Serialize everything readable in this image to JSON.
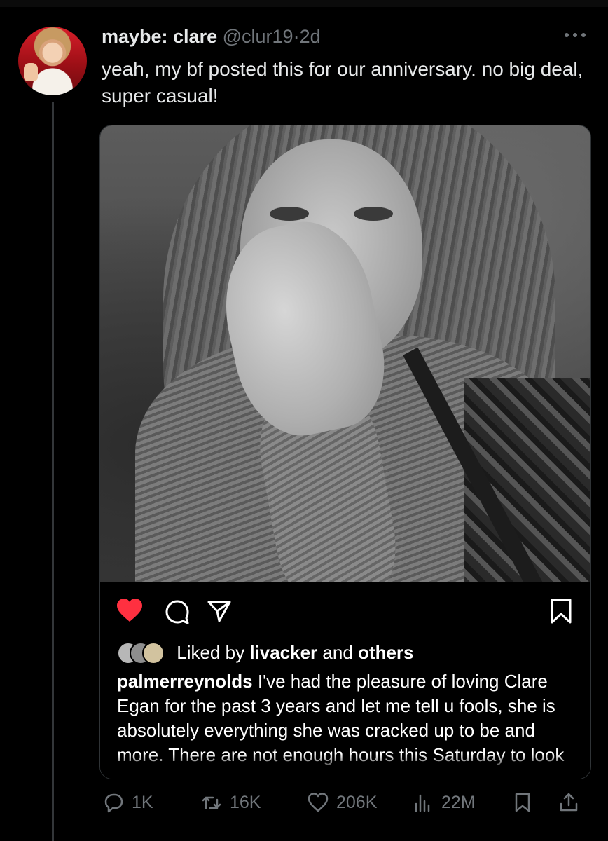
{
  "tweet": {
    "display_name": "maybe: clare",
    "handle": "@clur19",
    "separator": "·",
    "time": "2d",
    "text": "yeah, my bf posted this for our anniversary. no big deal, super casual!"
  },
  "instagram": {
    "liked_prefix": "Liked by",
    "liked_user": "livacker",
    "liked_and": "and",
    "liked_others": "others",
    "caption_user": "palmerreynolds",
    "caption_text": "I've had the pleasure of loving Clare Egan for the past 3 years and let me tell u fools, she is absolutely everything she was cracked up to be and more. There are not enough hours this Saturday to look her in the",
    "heart_color": "#ff3040"
  },
  "actions": {
    "replies": "1K",
    "retweets": "16K",
    "likes": "206K",
    "views": "22M"
  },
  "icons": [
    "more-icon",
    "heart-icon",
    "comment-icon",
    "share-icon",
    "save-icon",
    "reply-icon",
    "retweet-icon",
    "like-icon",
    "views-icon",
    "bookmark-icon",
    "share-tweet-icon"
  ]
}
